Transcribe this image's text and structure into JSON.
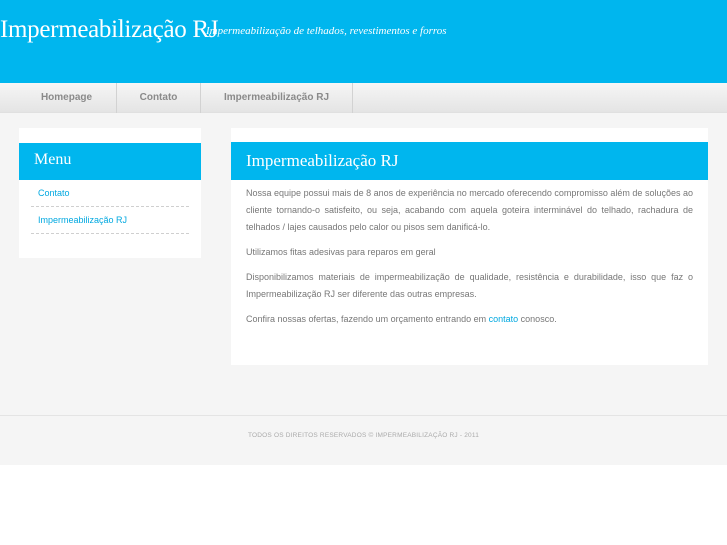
{
  "header": {
    "title": "Impermeabilização RJ",
    "tagline": "Impermeabilização de telhados, revestimentos e forros"
  },
  "nav": {
    "items": [
      {
        "label": "Homepage"
      },
      {
        "label": "Contato"
      },
      {
        "label": "Impermeabilização RJ"
      }
    ]
  },
  "sidebar": {
    "title": "Menu",
    "items": [
      {
        "label": "Contato"
      },
      {
        "label": "Impermeabilização RJ"
      }
    ]
  },
  "content": {
    "title": "Impermeabilização RJ",
    "paragraph1": "Nossa equipe possui mais de 8 anos de experiência no mercado oferecendo compromisso além de soluções ao cliente tornando-o satisfeito, ou seja, acabando com aquela goteira interminável do telhado, rachadura de telhados / lajes causados pelo calor ou pisos sem danificá-lo.",
    "paragraph2": "Utilizamos fitas adesivas para reparos em geral",
    "paragraph3": "Disponibilizamos materiais de impermeabilização de qualidade, resistência e durabilidade, isso que faz o Impermeabilização RJ ser diferente das outras empresas.",
    "paragraph4_before": "Confira nossas ofertas, fazendo um orçamento entrando em ",
    "paragraph4_link": "contato",
    "paragraph4_after": " conosco."
  },
  "footer": {
    "text": "TODOS OS DIREITOS RESERVADOS © IMPERMEABILIZAÇÃO RJ - 2011"
  },
  "colors": {
    "accent": "#00b6ee",
    "link": "#00a8e0",
    "background": "#f5f5f5"
  }
}
